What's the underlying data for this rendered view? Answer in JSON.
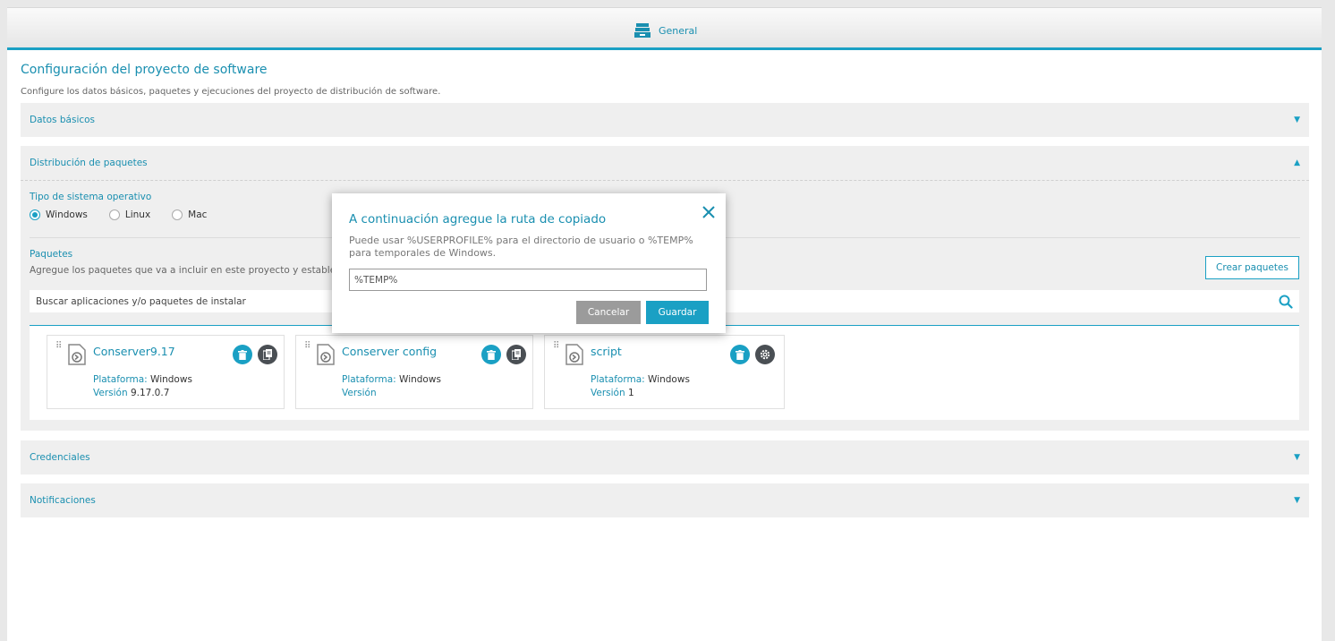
{
  "tab": {
    "label": "General",
    "icon": "archive-drawer-icon"
  },
  "page": {
    "title": "Configuración del proyecto de software",
    "description": "Configure los datos básicos, paquetes y ejecuciones del proyecto de distribución de software."
  },
  "sections": {
    "datos_basicos": "Datos básicos",
    "distribucion": "Distribución de paquetes",
    "credenciales": "Credenciales",
    "notificaciones": "Notificaciones"
  },
  "os": {
    "label": "Tipo de sistema operativo",
    "options": [
      "Windows",
      "Linux",
      "Mac"
    ],
    "selected": "Windows"
  },
  "packages": {
    "label": "Paquetes",
    "description": "Agregue los paquetes que va a incluir en este proyecto y establezc",
    "create_button": "Crear paquetes",
    "search_placeholder": "Buscar aplicaciones y/o paquetes de instalar",
    "items": [
      {
        "name": "Conserver9.17",
        "platform_key": "Plataforma:",
        "platform": "Windows",
        "version_key": "Versión",
        "version": "9.17.0.7",
        "secondary_icon": "copy-icon"
      },
      {
        "name": "Conserver config",
        "platform_key": "Plataforma:",
        "platform": "Windows",
        "version_key": "Versión",
        "version": "",
        "secondary_icon": "copy-icon"
      },
      {
        "name": "script",
        "platform_key": "Plataforma:",
        "platform": "Windows",
        "version_key": "Versión",
        "version": "1",
        "secondary_icon": "settings-icon"
      }
    ]
  },
  "modal": {
    "title": "A continuación agregue la ruta de copiado",
    "description": "Puede usar %USERPROFILE% para el directorio de usuario o %TEMP% para temporales de Windows.",
    "input_value": "%TEMP%",
    "cancel": "Cancelar",
    "save": "Guardar"
  },
  "colors": {
    "accent": "#1aa0c4",
    "dark_button": "#4a4f54",
    "cancel": "#9b9b9b"
  }
}
